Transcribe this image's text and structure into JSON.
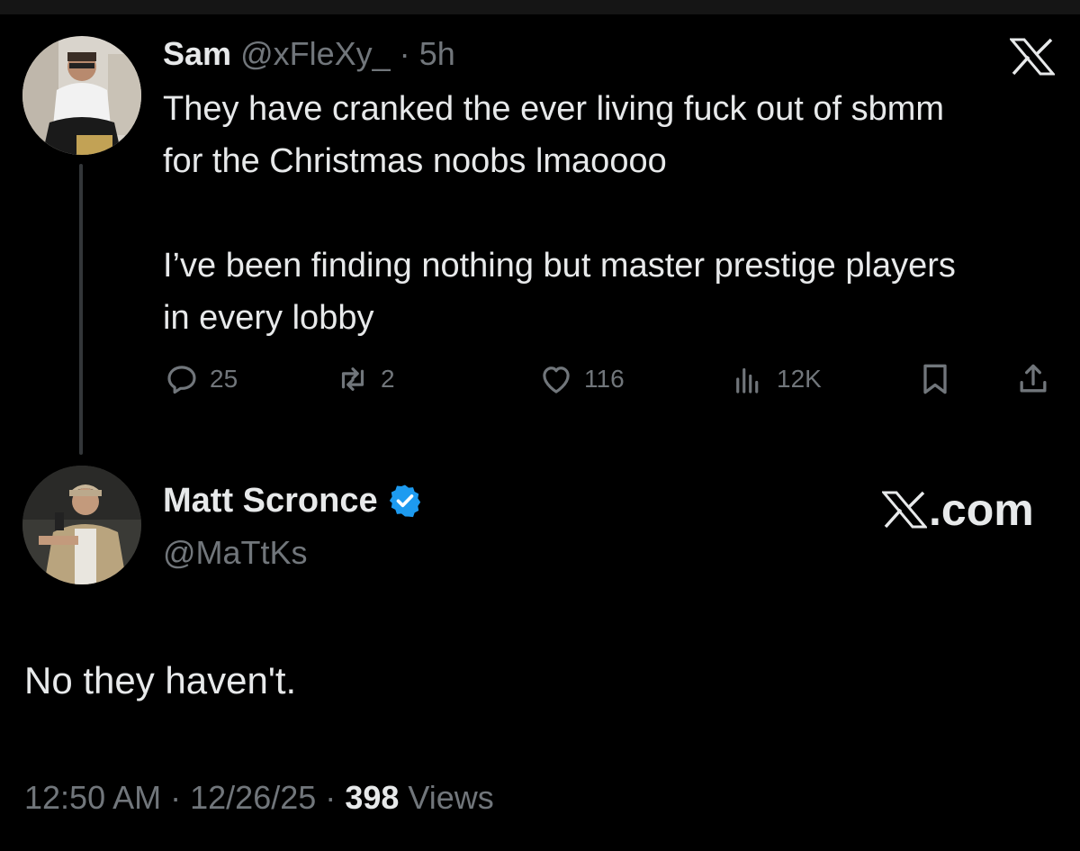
{
  "parent_tweet": {
    "author_name": "Sam",
    "author_handle": "@xFleXy_",
    "separator": "·",
    "time_ago": "5h",
    "text_paragraphs": [
      "They have cranked the ever living fuck out of sbmm for the Christmas noobs lmaoooo",
      "I’ve been finding nothing but master prestige players in every lobby"
    ],
    "stats": {
      "replies": "25",
      "reposts": "2",
      "likes": "116",
      "views": "12K"
    },
    "icons": [
      "reply-icon",
      "repost-icon",
      "like-icon",
      "views-icon",
      "bookmark-icon",
      "share-icon",
      "x-logo-icon"
    ]
  },
  "reply_tweet": {
    "author_name": "Matt Scronce",
    "author_handle": "@MaTtKs",
    "verified": true,
    "brand_label": ".com",
    "text": "No they haven't.",
    "time": "12:50 AM",
    "separator": "·",
    "date": "12/26/25",
    "views_count": "398",
    "views_label": "Views"
  },
  "colors": {
    "background": "#000000",
    "primary_text": "#e7e9ea",
    "secondary_text": "#71767b",
    "verified_blue": "#1d9bf0",
    "thread_line": "#333639"
  }
}
